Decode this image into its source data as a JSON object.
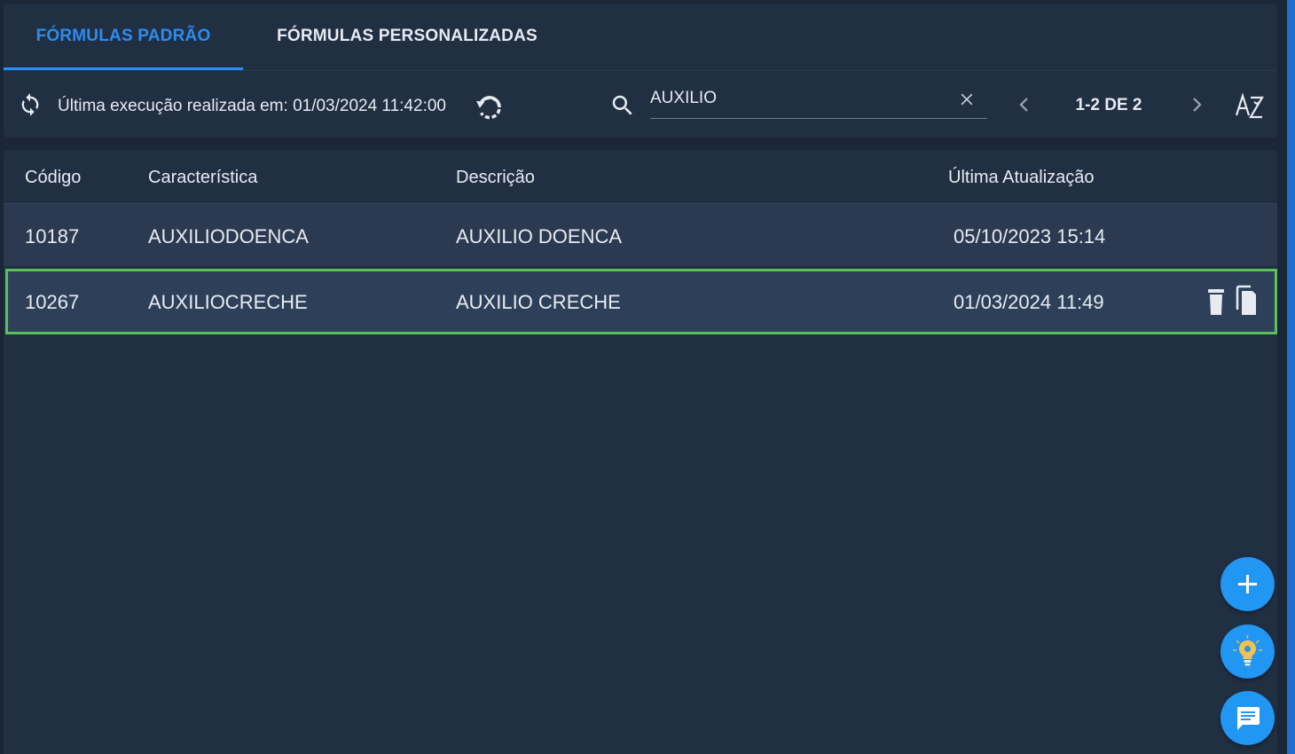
{
  "tabs": [
    {
      "label": "FÓRMULAS PADRÃO",
      "active": true
    },
    {
      "label": "FÓRMULAS PERSONALIZADAS",
      "active": false
    }
  ],
  "toolbar": {
    "last_execution": "Última execução realizada em: 01/03/2024 11:42:00",
    "search_value": "AUXILIO",
    "pagination": "1-2 DE 2",
    "icons": [
      "sync-icon",
      "history-icon",
      "search-icon",
      "clear-icon",
      "chevron-left-icon",
      "chevron-right-icon",
      "sort-az-icon"
    ]
  },
  "table": {
    "headers": [
      "Código",
      "Característica",
      "Descrição",
      "Última Atualização"
    ],
    "rows": [
      {
        "codigo": "10187",
        "caracteristica": "AUXILIODOENCA",
        "descricao": "AUXILIO DOENCA",
        "atualizacao": "05/10/2023 15:14"
      },
      {
        "codigo": "10267",
        "caracteristica": "AUXILIOCRECHE",
        "descricao": "AUXILIO CRECHE",
        "atualizacao": "01/03/2024 11:49",
        "selected": true
      }
    ]
  },
  "fabs": [
    "add-icon",
    "lightbulb-icon",
    "chat-icon"
  ],
  "colors": {
    "accent": "#2d8cf0",
    "background": "#1b2636",
    "card": "#212f42",
    "selected_border": "#5cc05c",
    "fab": "#2196f3"
  }
}
